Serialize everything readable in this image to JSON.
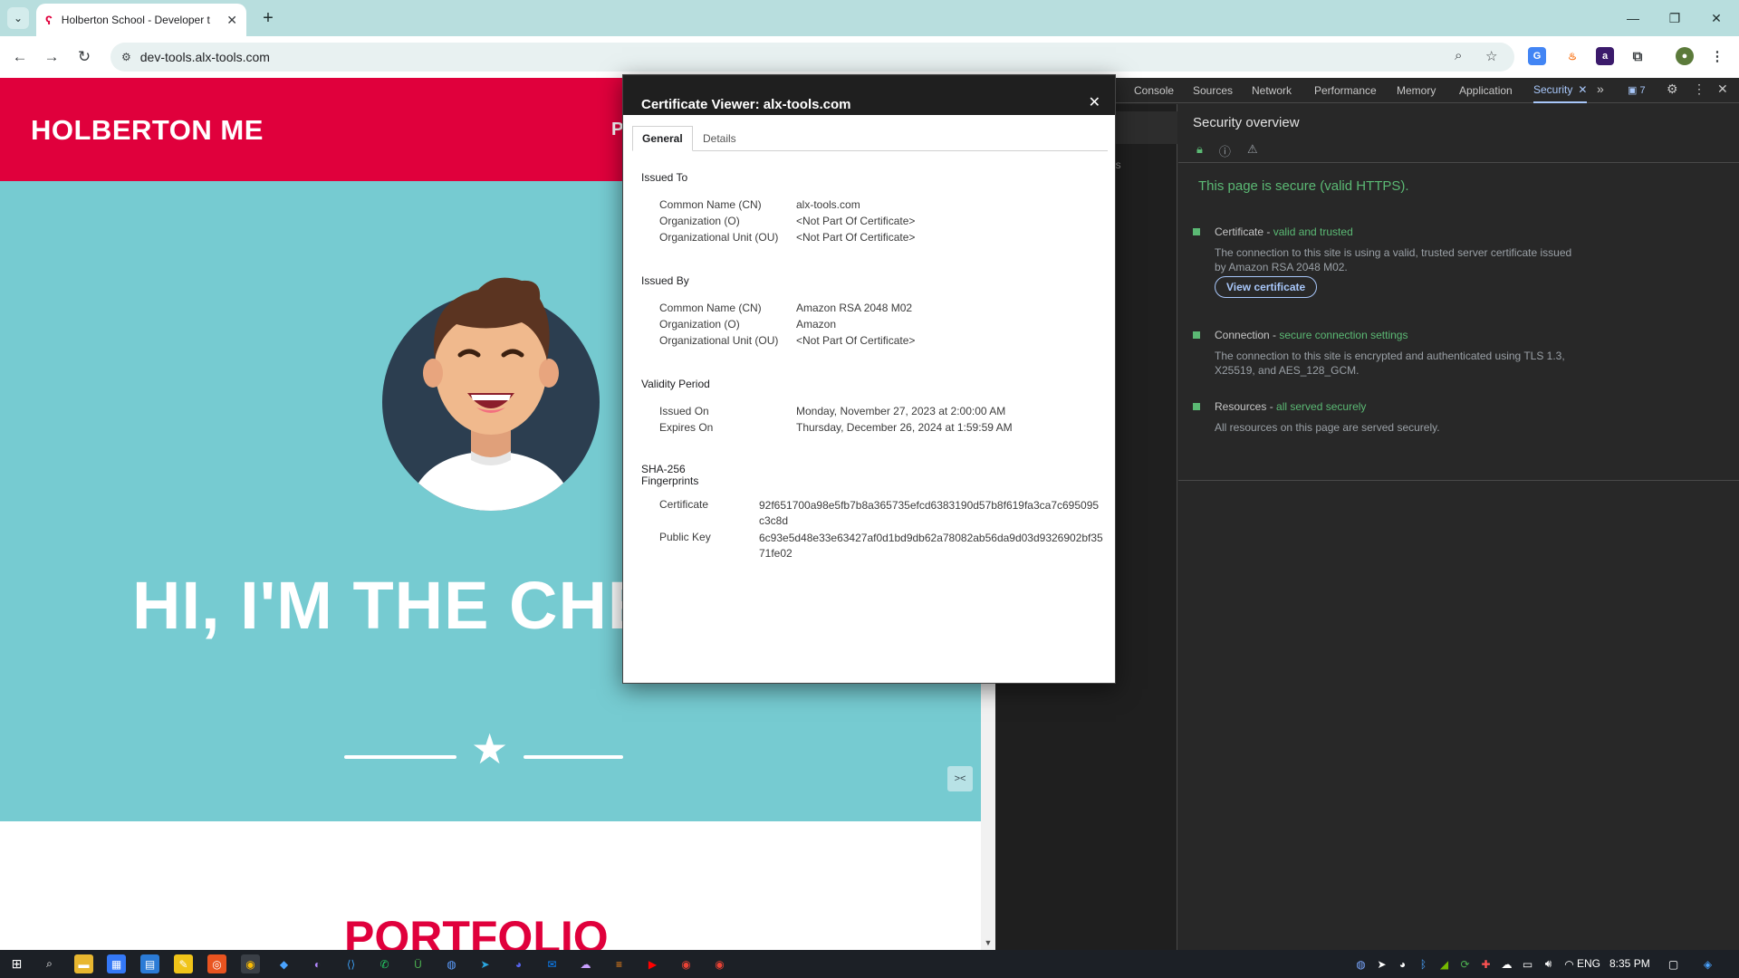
{
  "browser": {
    "tab_title": "Holberton School - Developer t",
    "url": "dev-tools.alx-tools.com"
  },
  "page": {
    "brand": "HOLBERTON ME",
    "nav_partial": "P",
    "hero_title": "HI, I'M THE CHE",
    "section_title": "PORTFOLIO"
  },
  "devtools": {
    "tabs": [
      "Console",
      "Sources",
      "Network",
      "Performance",
      "Memory",
      "Application",
      "Security"
    ],
    "active_tab": "Security",
    "issues_count": "7",
    "left_partial_text": "ls",
    "heading": "Security overview",
    "status": "This page is secure (valid HTTPS).",
    "items": [
      {
        "label": "Certificate - ",
        "highlight": "valid and trusted",
        "desc": "The connection to this site is using a valid, trusted server certificate issued by Amazon RSA 2048 M02.",
        "button": "View certificate"
      },
      {
        "label": "Connection - ",
        "highlight": "secure connection settings",
        "desc": "The connection to this site is encrypted and authenticated using TLS 1.3, X25519, and AES_128_GCM."
      },
      {
        "label": "Resources - ",
        "highlight": "all served securely",
        "desc": "All resources on this page are served securely."
      }
    ]
  },
  "cert_dialog": {
    "title": "Certificate Viewer: alx-tools.com",
    "tabs": [
      "General",
      "Details"
    ],
    "issued_to": {
      "heading": "Issued To",
      "cn_label": "Common Name (CN)",
      "cn": "alx-tools.com",
      "o_label": "Organization (O)",
      "o": "<Not Part Of Certificate>",
      "ou_label": "Organizational Unit (OU)",
      "ou": "<Not Part Of Certificate>"
    },
    "issued_by": {
      "heading": "Issued By",
      "cn_label": "Common Name (CN)",
      "cn": "Amazon RSA 2048 M02",
      "o_label": "Organization (O)",
      "o": "Amazon",
      "ou_label": "Organizational Unit (OU)",
      "ou": "<Not Part Of Certificate>"
    },
    "validity": {
      "heading": "Validity Period",
      "issued_label": "Issued On",
      "issued": "Monday, November 27, 2023 at 2:00:00 AM",
      "expires_label": "Expires On",
      "expires": "Thursday, December 26, 2024 at 1:59:59 AM"
    },
    "fingerprints": {
      "heading_1": "SHA-256",
      "heading_2": "Fingerprints",
      "cert_label": "Certificate",
      "cert": "92f651700a98e5fb7b8a365735efcd6383190d57b8f619fa3ca7c695095c3c8d",
      "key_label": "Public Key",
      "key": "6c93e5d48e33e63427af0d1bd9db62a78082ab56da9d03d9326902bf3571fe02"
    }
  },
  "taskbar": {
    "lang": "ENG",
    "time": "8:35 PM"
  },
  "colors": {
    "brand_red": "#e0003c",
    "hero_teal": "#76cbd1",
    "secure_green": "#5bb974",
    "devtools_accent": "#a8c7fa"
  }
}
